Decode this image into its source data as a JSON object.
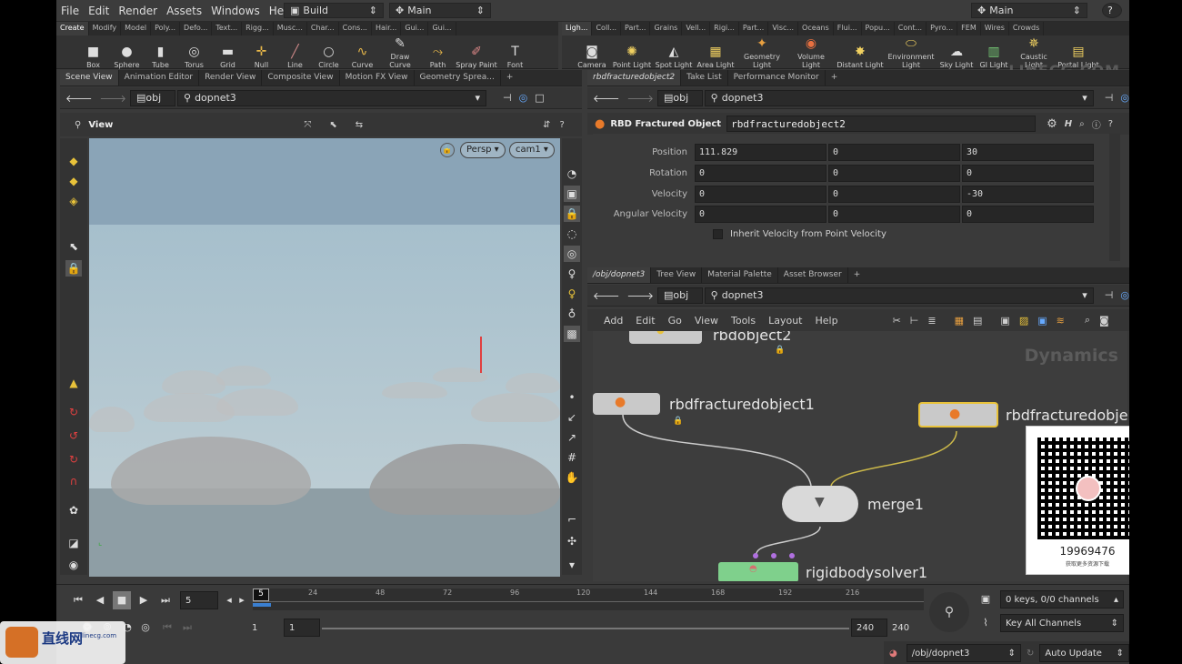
{
  "menubar": {
    "items": [
      "File",
      "Edit",
      "Render",
      "Assets",
      "Windows",
      "Help"
    ],
    "build_desk": "Build",
    "main_desk": "Main",
    "right_desk": "Main",
    "help": "?"
  },
  "shelf_left": {
    "tabs": [
      "Create",
      "Modify",
      "Model",
      "Poly...",
      "Defo...",
      "Text...",
      "Rigg...",
      "Musc...",
      "Char...",
      "Cons...",
      "Hair...",
      "Gui...",
      "Gui..."
    ],
    "tools": [
      "Box",
      "Sphere",
      "Tube",
      "Torus",
      "Grid",
      "Null",
      "Line",
      "Circle",
      "Curve",
      "Draw Curve",
      "Path",
      "Spray Paint",
      "Font"
    ]
  },
  "shelf_right": {
    "tabs": [
      "Ligh...",
      "Coll...",
      "Part...",
      "Grains",
      "Vell...",
      "Rigi...",
      "Part...",
      "Visc...",
      "Oceans",
      "Flui...",
      "Popu...",
      "Cont...",
      "Pyro...",
      "FEM",
      "Wires",
      "Crowds"
    ],
    "tools": [
      "Camera",
      "Point Light",
      "Spot Light",
      "Area Light",
      "Geometry Light",
      "Volume Light",
      "Distant Light",
      "Environment Light",
      "Sky Light",
      "GI Light",
      "Caustic Light",
      "Portal Light"
    ]
  },
  "left_pane": {
    "tabs": [
      "Scene View",
      "Animation Editor",
      "Render View",
      "Composite View",
      "Motion FX View",
      "Geometry Sprea..."
    ],
    "path_root": "obj",
    "path_node": "dopnet3",
    "view_label": "View",
    "persp": "Persp",
    "cam": "cam1"
  },
  "param_pane": {
    "tabs": [
      "rbdfracturedobject2",
      "Take List",
      "Performance Monitor"
    ],
    "path_root": "obj",
    "path_node": "dopnet3",
    "node_type": "RBD Fractured Object",
    "node_name": "rbdfracturedobject2",
    "rows": [
      {
        "label": "Position",
        "v1": "111.829",
        "v2": "0",
        "v3": "30"
      },
      {
        "label": "Rotation",
        "v1": "0",
        "v2": "0",
        "v3": "0"
      },
      {
        "label": "Velocity",
        "v1": "0",
        "v2": "0",
        "v3": "-30"
      },
      {
        "label": "Angular Velocity",
        "v1": "0",
        "v2": "0",
        "v3": "0"
      }
    ],
    "checkbox_label": "Inherit Velocity from Point Velocity"
  },
  "network_pane": {
    "tabs": [
      "/obj/dopnet3",
      "Tree View",
      "Material Palette",
      "Asset Browser"
    ],
    "path_root": "obj",
    "path_node": "dopnet3",
    "menu": [
      "Add",
      "Edit",
      "Go",
      "View",
      "Tools",
      "Layout",
      "Help"
    ],
    "context_label": "Dynamics",
    "nodes": {
      "top": "rbdobject2",
      "left": "rbdfracturedobject1",
      "right": "rbdfracturedobje",
      "merge": "merge1",
      "solver": "rigidbodysolver1"
    }
  },
  "timeline": {
    "current_frame": "5",
    "frame_marker": "5",
    "ticks": [
      "24",
      "48",
      "72",
      "96",
      "120",
      "144",
      "168",
      "192",
      "216"
    ],
    "start": "1",
    "start2": "1",
    "end": "240",
    "end2": "240",
    "keys_status": "0 keys, 0/0 channels",
    "key_all": "Key All Channels",
    "path": "/obj/dopnet3",
    "update_mode": "Auto Update"
  },
  "watermark": {
    "linecg": "LINECG.COM",
    "qr_number": "19969476",
    "qr_text1": "关注我们加群",
    "qr_text2": "获取更多资源下载",
    "logo_text": "直线网",
    "logo_sub": "linecg.com"
  },
  "colors": {
    "accent_yellow": "#e8c23a",
    "node_green": "#7fd08c",
    "viewport_sky": "#87a3b7"
  }
}
